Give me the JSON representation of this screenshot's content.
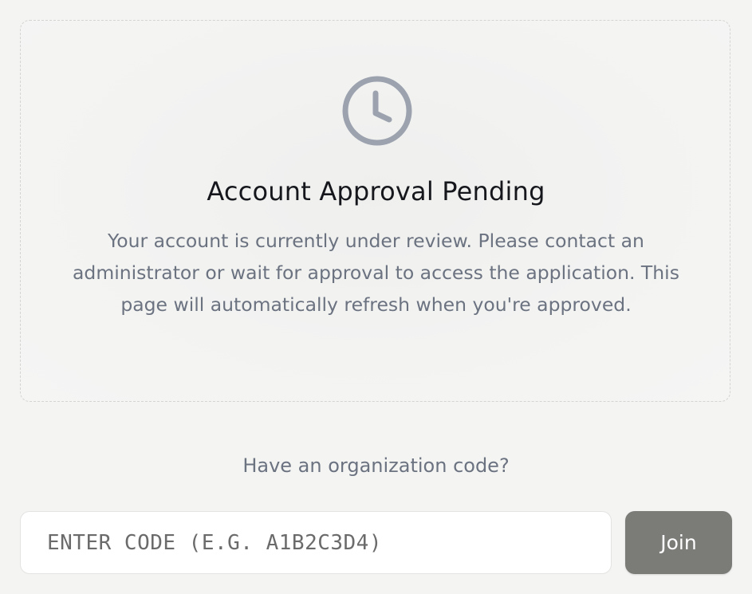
{
  "approval_card": {
    "icon": "clock-icon",
    "title": "Account Approval Pending",
    "message": "Your account is currently under review. Please contact an administrator or wait for approval to access the application. This page will automatically refresh when you're approved."
  },
  "organization": {
    "prompt": "Have an organization code?",
    "code_input": {
      "value": "",
      "placeholder": "ENTER CODE (E.G. A1B2C3D4)"
    },
    "join_label": "Join"
  },
  "colors": {
    "background": "#f4f4f3",
    "icon": "#9ca3af",
    "title": "#15171c",
    "muted_text": "#6b7280",
    "join_button": "#7b7b78"
  }
}
